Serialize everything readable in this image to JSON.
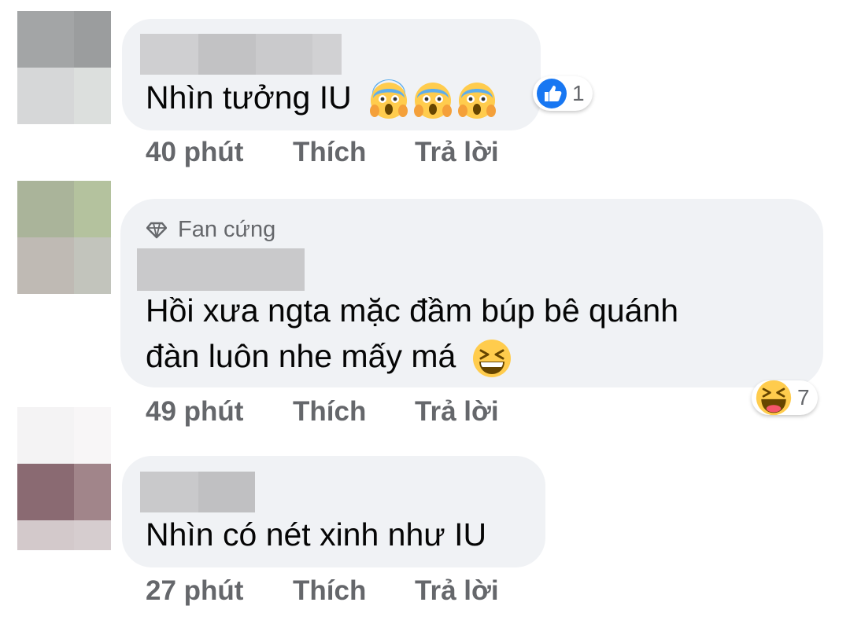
{
  "colors": {
    "bubble": "#f0f2f5",
    "meta_text": "#65676b",
    "body_text": "#050505",
    "like_blue": "#1877f2",
    "emoji_yellow": "#ffcc4d"
  },
  "comments": [
    {
      "text_lines": [
        "Nhìn tưởng IU"
      ],
      "emoji_icons": [
        "screaming-face-icon",
        "screaming-face-icon",
        "screaming-face-icon"
      ],
      "reaction": {
        "icon": "like-icon",
        "count": "1"
      },
      "time": "40 phút",
      "like_label": "Thích",
      "reply_label": "Trả lời"
    },
    {
      "badge": "Fan cứng",
      "badge_icon": "diamond-icon",
      "text_lines": [
        "Hồi xưa ngta mặc đầm búp bê quánh",
        "đàn luôn nhe mấy má"
      ],
      "emoji_icons": [
        "grinning-squinting-face-icon"
      ],
      "reaction": {
        "icon": "haha-icon",
        "count": "7"
      },
      "time": "49 phút",
      "like_label": "Thích",
      "reply_label": "Trả lời"
    },
    {
      "text_lines": [
        "Nhìn có nét xinh như IU"
      ],
      "time": "27 phút",
      "like_label": "Thích",
      "reply_label": "Trả lời"
    }
  ]
}
